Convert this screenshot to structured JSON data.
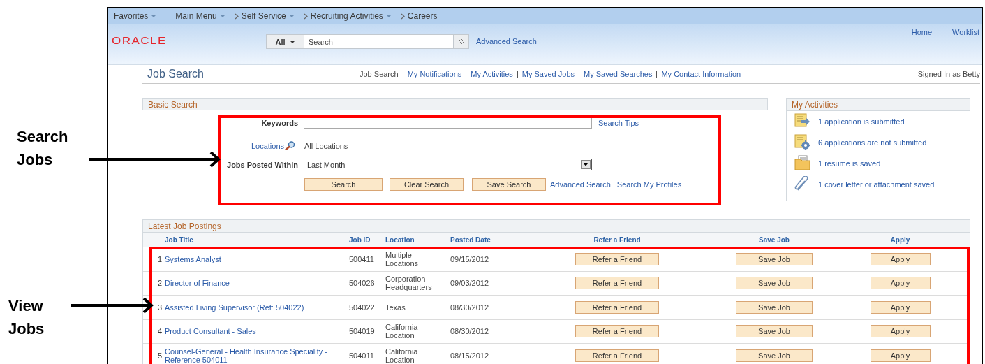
{
  "annotations": [
    {
      "label": "Search Jobs"
    },
    {
      "label": "View Jobs"
    }
  ],
  "nav": {
    "items": [
      {
        "label": "Favorites",
        "has_menu": true
      },
      {
        "label": "Main Menu",
        "has_menu": true
      },
      {
        "label": "Self Service",
        "has_menu": true
      },
      {
        "label": "Recruiting Activities",
        "has_menu": true
      },
      {
        "label": "Careers",
        "has_menu": false
      }
    ]
  },
  "header": {
    "logo": "ORACLE",
    "search": {
      "scope": "All",
      "placeholder": "Search"
    },
    "advanced_link": "Advanced Search",
    "links": [
      "Home",
      "Worklist"
    ]
  },
  "page": {
    "title": "Job Search",
    "links": [
      {
        "label": "Job Search",
        "selected": true
      },
      {
        "label": "My Notifications",
        "selected": false
      },
      {
        "label": "My Activities",
        "selected": false
      },
      {
        "label": "My Saved Jobs",
        "selected": false
      },
      {
        "label": "My Saved Searches",
        "selected": false
      },
      {
        "label": "My Contact Information",
        "selected": false
      }
    ],
    "signed_in": "Signed In as Betty"
  },
  "basic_search": {
    "title": "Basic Search",
    "keywords_label": "Keywords",
    "search_tips": "Search Tips",
    "locations_link": "Locations",
    "locations_value": "All Locations",
    "posted_label": "Jobs Posted Within",
    "posted_value": "Last Month",
    "buttons": [
      "Search",
      "Clear Search",
      "Save Search"
    ],
    "links": [
      "Advanced Search",
      "Search My Profiles"
    ]
  },
  "activities": {
    "title": "My Activities",
    "items": [
      {
        "kind": "submitted",
        "text": "1 application is submitted"
      },
      {
        "kind": "pending",
        "text": "6 applications are not submitted"
      },
      {
        "kind": "resume",
        "text": "1 resume is saved"
      },
      {
        "kind": "attachment",
        "text": "1 cover letter or attachment saved"
      }
    ]
  },
  "postings": {
    "title": "Latest Job Postings",
    "columns": [
      "Job Title",
      "Job ID",
      "Location",
      "Posted Date",
      "Refer a Friend",
      "Save Job",
      "Apply"
    ],
    "rows": [
      {
        "number": "1",
        "title": "Systems Analyst",
        "job_id": "500411",
        "location": "Multiple Locations",
        "posted": "09/15/2012",
        "refer": "Refer a Friend",
        "save": "Save Job",
        "apply": "Apply"
      },
      {
        "number": "2",
        "title": "Director of Finance",
        "job_id": "504026",
        "location": "Corporation Headquarters",
        "posted": "09/03/2012",
        "refer": "Refer a Friend",
        "save": "Save Job",
        "apply": "Apply"
      },
      {
        "number": "3",
        "title": "Assisted Living Supervisor (Ref: 504022)",
        "job_id": "504022",
        "location": "Texas",
        "posted": "08/30/2012",
        "refer": "Refer a Friend",
        "save": "Save Job",
        "apply": "Apply"
      },
      {
        "number": "4",
        "title": "Product Consultant - Sales",
        "job_id": "504019",
        "location": "California Location",
        "posted": "08/30/2012",
        "refer": "Refer a Friend",
        "save": "Save Job",
        "apply": "Apply"
      },
      {
        "number": "5",
        "title": "Counsel-General - Health Insurance Speciality - Reference 504011",
        "job_id": "504011",
        "location": "California Location",
        "posted": "08/15/2012",
        "refer": "Refer a Friend",
        "save": "Save Job",
        "apply": "Apply"
      }
    ]
  }
}
